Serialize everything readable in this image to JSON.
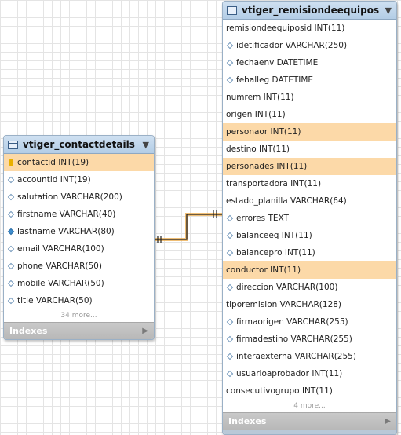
{
  "tables": {
    "contactdetails": {
      "name": "vtiger_contactdetails",
      "columns": [
        {
          "text": "contactid INT(19)",
          "marker": "key",
          "highlight": true
        },
        {
          "text": "accountid INT(19)",
          "marker": "diamond",
          "highlight": false
        },
        {
          "text": "salutation VARCHAR(200)",
          "marker": "diamond",
          "highlight": false
        },
        {
          "text": "firstname VARCHAR(40)",
          "marker": "diamond",
          "highlight": false
        },
        {
          "text": "lastname VARCHAR(80)",
          "marker": "diamond-filled",
          "highlight": false
        },
        {
          "text": "email VARCHAR(100)",
          "marker": "diamond",
          "highlight": false
        },
        {
          "text": "phone VARCHAR(50)",
          "marker": "diamond",
          "highlight": false
        },
        {
          "text": "mobile VARCHAR(50)",
          "marker": "diamond",
          "highlight": false
        },
        {
          "text": "title VARCHAR(50)",
          "marker": "diamond",
          "highlight": false
        }
      ],
      "more": "34 more...",
      "indexes_label": "Indexes"
    },
    "remision": {
      "name": "vtiger_remisiondeequipos",
      "columns": [
        {
          "text": "remisiondeequiposid INT(11)",
          "marker": "none",
          "highlight": false
        },
        {
          "text": "idetificador VARCHAR(250)",
          "marker": "diamond",
          "highlight": false
        },
        {
          "text": "fechaenv DATETIME",
          "marker": "diamond",
          "highlight": false
        },
        {
          "text": "fehalleg DATETIME",
          "marker": "diamond",
          "highlight": false
        },
        {
          "text": "numrem INT(11)",
          "marker": "none",
          "highlight": false
        },
        {
          "text": "origen INT(11)",
          "marker": "none",
          "highlight": false
        },
        {
          "text": "personaor INT(11)",
          "marker": "none",
          "highlight": true
        },
        {
          "text": "destino INT(11)",
          "marker": "none",
          "highlight": false
        },
        {
          "text": "personades INT(11)",
          "marker": "none",
          "highlight": true
        },
        {
          "text": "transportadora INT(11)",
          "marker": "none",
          "highlight": false
        },
        {
          "text": "estado_planilla VARCHAR(64)",
          "marker": "none",
          "highlight": false
        },
        {
          "text": "errores TEXT",
          "marker": "diamond",
          "highlight": false
        },
        {
          "text": "balanceeq INT(11)",
          "marker": "diamond",
          "highlight": false
        },
        {
          "text": "balancepro INT(11)",
          "marker": "diamond",
          "highlight": false
        },
        {
          "text": "conductor INT(11)",
          "marker": "none",
          "highlight": true
        },
        {
          "text": "direccion VARCHAR(100)",
          "marker": "diamond",
          "highlight": false
        },
        {
          "text": "tiporemision VARCHAR(128)",
          "marker": "none",
          "highlight": false
        },
        {
          "text": "firmaorigen VARCHAR(255)",
          "marker": "diamond",
          "highlight": false
        },
        {
          "text": "firmadestino VARCHAR(255)",
          "marker": "diamond",
          "highlight": false
        },
        {
          "text": "interaexterna VARCHAR(255)",
          "marker": "diamond",
          "highlight": false
        },
        {
          "text": "usuarioaprobador INT(11)",
          "marker": "diamond",
          "highlight": false
        },
        {
          "text": "consecutivogrupo INT(11)",
          "marker": "none",
          "highlight": false
        }
      ],
      "more": "4 more...",
      "indexes_label": "Indexes"
    }
  },
  "colors": {
    "highlight": "#fcd9a8",
    "connector": "#e8a33a",
    "header": "#b3cde6"
  }
}
